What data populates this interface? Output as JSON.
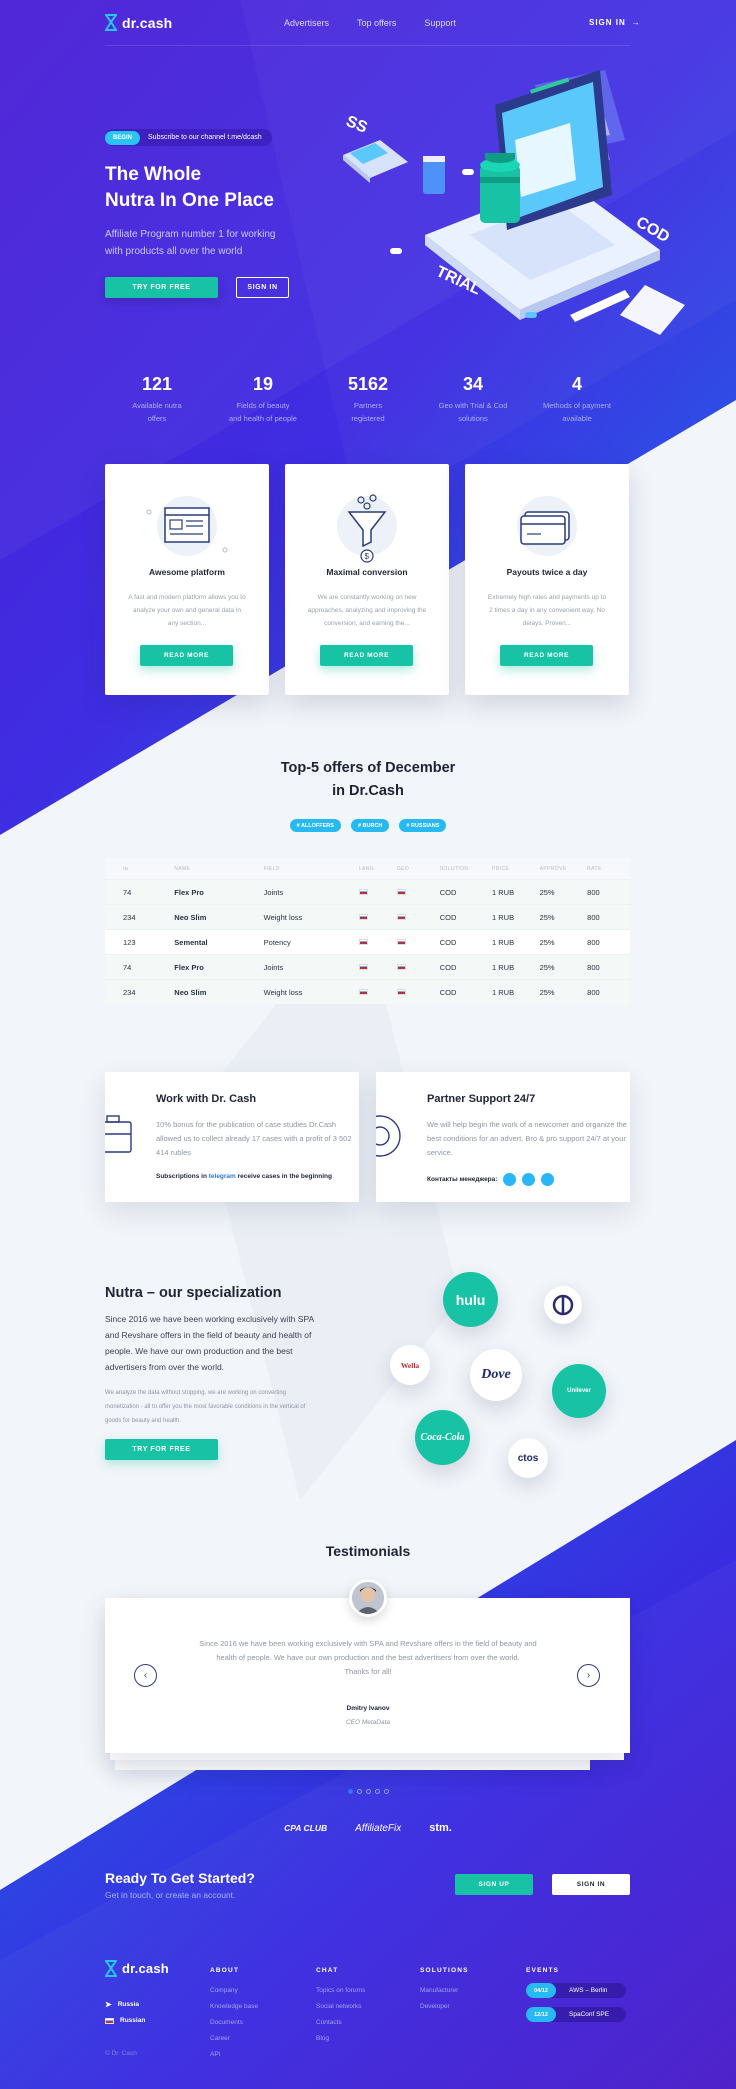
{
  "brand": {
    "name": "dr.cash"
  },
  "nav": {
    "items": [
      "Advertisers",
      "Top offers",
      "Support"
    ],
    "signin": "SIGN IN"
  },
  "hero": {
    "badge": "BEGIN",
    "chip_text": "Subscribe to our channel t.me/dcash",
    "title_line1": "The Whole",
    "title_line2": "Nutra In One Place",
    "subtitle_line1": "Affiliate Program number 1 for working",
    "subtitle_line2": "with products all over the world",
    "try_button": "TRY FOR FREE",
    "signin_button": "SIGN IN",
    "illustration_words": [
      "SS",
      "COD",
      "TRIAL"
    ]
  },
  "stats": [
    {
      "value": "121",
      "label1": "Available nutra",
      "label2": "offers"
    },
    {
      "value": "19",
      "label1": "Fields of beauty",
      "label2": "and health of people"
    },
    {
      "value": "5162",
      "label1": "Partners",
      "label2": "registered"
    },
    {
      "value": "34",
      "label1": "Geo with Trial & Cod",
      "label2": "solutions"
    },
    {
      "value": "4",
      "label1": "Methods of payment",
      "label2": "available"
    }
  ],
  "features": [
    {
      "title": "Awesome platform",
      "desc": "A fast and modern platform allows you to analyze your own and general data in any section...",
      "button": "READ MORE",
      "icon": "browser-window-icon"
    },
    {
      "title": "Maximal conversion",
      "desc": "We are constantly working on new approaches, analyzing and improving the conversion, and earning the...",
      "button": "READ MORE",
      "icon": "funnel-icon"
    },
    {
      "title": "Payouts twice a day",
      "desc": "Extremely high rates and payments up to 2 times a day in any convenient way. No delays. Proven...",
      "button": "READ MORE",
      "icon": "credit-card-icon"
    }
  ],
  "offers": {
    "title_line1": "Top-5 offers of December",
    "title_line2": "in Dr.Cash",
    "tags": [
      "# ALLOFFERS",
      "# BURCH",
      "# RUSSIANS"
    ],
    "headers": [
      "№",
      "NAME",
      "FIELD",
      "LANG",
      "GEO",
      "SOLUTION",
      "PRICE",
      "APPROVE",
      "RATE"
    ],
    "rows": [
      {
        "id": "74",
        "name": "Flex Pro",
        "field": "Joints",
        "solution": "COD",
        "price": "1 RUB",
        "approve": "25%",
        "rate": "800"
      },
      {
        "id": "234",
        "name": "Neo Slim",
        "field": "Weight loss",
        "solution": "COD",
        "price": "1 RUB",
        "approve": "25%",
        "rate": "800"
      },
      {
        "id": "123",
        "name": "Semental",
        "field": "Potency",
        "solution": "COD",
        "price": "1 RUB",
        "approve": "25%",
        "rate": "800"
      },
      {
        "id": "74",
        "name": "Flex Pro",
        "field": "Joints",
        "solution": "COD",
        "price": "1 RUB",
        "approve": "25%",
        "rate": "800"
      },
      {
        "id": "234",
        "name": "Neo Slim",
        "field": "Weight loss",
        "solution": "COD",
        "price": "1 RUB",
        "approve": "25%",
        "rate": "800"
      }
    ]
  },
  "work": {
    "title": "Work with Dr. Cash",
    "text": "10% bonus for the publication of case studies Dr.Cash allowed us to collect already 17 cases with a profit of 3 502 414 rubles",
    "foot_a": "Subscriptions in ",
    "foot_link": "telegram",
    "foot_b": " receive cases in the beginning"
  },
  "support": {
    "title": "Partner Support 24/7",
    "text": "We will help begin the work of a newcomer and organize the best conditions for an advert. Bro & pro support 24/7 at your service.",
    "foot": "Контакты менеджера:"
  },
  "nutra": {
    "title": "Nutra – our specialization",
    "text": "Since 2016 we have been working exclusively with SPA and Revshare offers in the field of beauty and health of people. We have our own production and the best advertisers from over the world.",
    "small": "We analyze the data without stopping, we are working on converting monetization - all to offer you the most favorable conditions in the vertical of goods for beauty and health.",
    "button": "TRY FOR FREE",
    "brands": [
      "hulu",
      "Wella",
      "Dove",
      "Unilever",
      "Coca-Cola",
      "ctos"
    ]
  },
  "testimonials": {
    "title": "Testimonials",
    "text": "Since 2016 we have been working exclusively with SPA and Revshare offers in the field of beauty and health of people. We have our own production and the best advertisers from over the world.",
    "thanks": "Thanks for all!",
    "name": "Dmitry Ivanov",
    "role": "CEO MetaData"
  },
  "partners": [
    "CPA CLUB",
    "AffiliateFix",
    "stm."
  ],
  "cta": {
    "title": "Ready To Get Started?",
    "sub": "Get in touch, or create an account.",
    "signup": "SIGN UP",
    "signin": "SIGN IN"
  },
  "footer": {
    "languages": [
      "Russia",
      "Russian"
    ],
    "copyright": "© Dr. Cash",
    "about": {
      "title": "ABOUT",
      "items": [
        "Company",
        "Knowledge base",
        "Documents",
        "Career",
        "API"
      ]
    },
    "chat": {
      "title": "CHAT",
      "items": [
        "Topics on forums",
        "Social networks",
        "Contacts",
        "Blog"
      ]
    },
    "solutions": {
      "title": "SOLUTIONS",
      "items": [
        "Manufacturer",
        "Developer"
      ]
    },
    "events": {
      "title": "EVENTS",
      "items": [
        {
          "date": "04/12",
          "name": "AWS – Berlin"
        },
        {
          "date": "12/12",
          "name": "SpaConf SPE"
        }
      ]
    }
  },
  "colors": {
    "primary_blue": "#3a2be0",
    "accent_green": "#17c3a4",
    "accent_cyan": "#27b9f1",
    "text_dark": "#1f2436"
  }
}
